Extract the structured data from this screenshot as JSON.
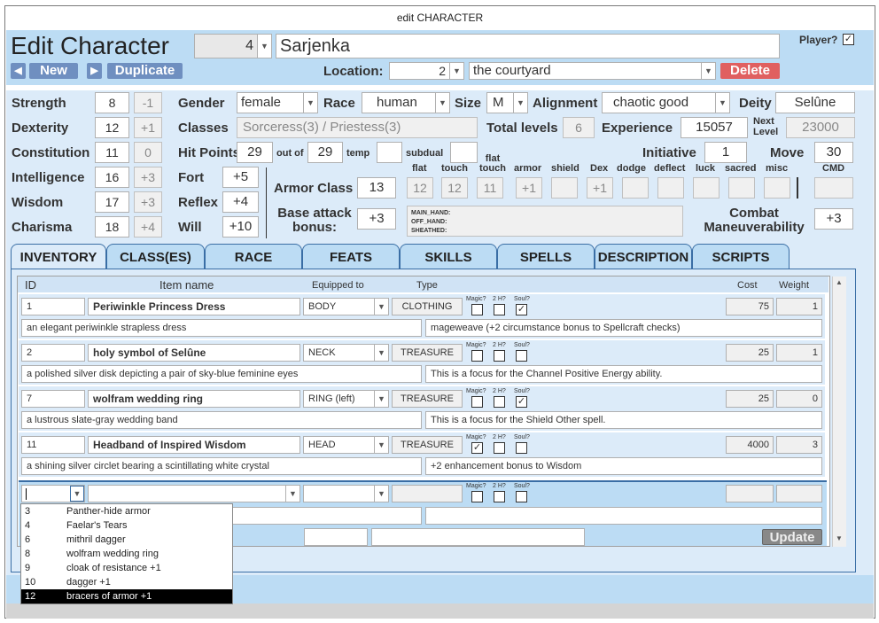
{
  "window_title": "edit CHARACTER",
  "header": {
    "title": "Edit Character",
    "id_value": "4",
    "name_value": "Sarjenka",
    "player_label": "Player?",
    "player_checked": "☑",
    "new_label": "New",
    "duplicate_label": "Duplicate",
    "location_label": "Location:",
    "location_id": "2",
    "location_name": "the courtyard",
    "delete_label": "Delete"
  },
  "abilities": [
    {
      "label": "Strength",
      "value": "8",
      "mod": "-1"
    },
    {
      "label": "Dexterity",
      "value": "12",
      "mod": "+1"
    },
    {
      "label": "Constitution",
      "value": "11",
      "mod": "0"
    },
    {
      "label": "Intelligence",
      "value": "16",
      "mod": "+3"
    },
    {
      "label": "Wisdom",
      "value": "17",
      "mod": "+3"
    },
    {
      "label": "Charisma",
      "value": "18",
      "mod": "+4"
    }
  ],
  "info": {
    "gender_label": "Gender",
    "gender": "female",
    "race_label": "Race",
    "race": "human",
    "size_label": "Size",
    "size": "M",
    "alignment_label": "Alignment",
    "alignment": "chaotic good",
    "deity_label": "Deity",
    "deity": "Selûne",
    "classes_label": "Classes",
    "classes": "Sorceress(3) / Priestess(3)",
    "total_levels_label": "Total levels",
    "total_levels": "6",
    "experience_label": "Experience",
    "experience": "15057",
    "next_level_label": "Next Level",
    "next_level": "23000",
    "hp_label": "Hit Points",
    "hp": "29",
    "outof_label": "out of",
    "hp_max": "29",
    "temp_label": "temp",
    "subdual_label": "subdual",
    "initiative_label": "Initiative",
    "initiative": "1",
    "move_label": "Move",
    "move": "30"
  },
  "saves": [
    {
      "label": "Fort",
      "value": "+5"
    },
    {
      "label": "Reflex",
      "value": "+4"
    },
    {
      "label": "Will",
      "value": "+10"
    }
  ],
  "armor": {
    "label": "Armor Class",
    "value": "13",
    "flat": "12",
    "touch": "12",
    "flat_touch": "11",
    "armor": "+1",
    "shield": "",
    "dex": "+1",
    "col_flat": "flat",
    "col_touch": "touch",
    "col_flat_touch": "flat touch",
    "col_armor": "armor",
    "col_shield": "shield",
    "col_dex": "Dex",
    "col_dodge": "dodge",
    "col_deflect": "deflect",
    "col_luck": "luck",
    "col_sacred": "sacred",
    "col_misc": "misc",
    "col_cmd": "CMD"
  },
  "bab": {
    "label": "Base attack bonus:",
    "value": "+3",
    "main_hand": "MAIN_HAND:",
    "off_hand": "OFF_HAND:",
    "sheathed": "SHEATHED:"
  },
  "cmb": {
    "label": "Combat Maneuverability",
    "value": "+3"
  },
  "tabs": [
    "INVENTORY",
    "CLASS(ES)",
    "RACE",
    "FEATS",
    "SKILLS",
    "SPELLS",
    "DESCRIPTION",
    "SCRIPTS"
  ],
  "inventory": {
    "headers": {
      "id": "ID",
      "name": "Item name",
      "equipped": "Equipped to",
      "type": "Type",
      "cost": "Cost",
      "weight": "Weight"
    },
    "check_labels": {
      "magic": "Magic?",
      "two_h": "2 H?",
      "soul": "Soul?"
    },
    "items": [
      {
        "id": "1",
        "name": "Periwinkle Princess Dress",
        "slot": "BODY",
        "type": "CLOTHING",
        "magic": "",
        "two_h": "",
        "soul": "✓",
        "cost": "75",
        "weight": "1",
        "desc": "an elegant periwinkle strapless dress",
        "note": "mageweave (+2 circumstance bonus to Spellcraft checks)"
      },
      {
        "id": "2",
        "name": "holy symbol of Selûne",
        "slot": "NECK",
        "type": "TREASURE",
        "magic": "",
        "two_h": "",
        "soul": "",
        "cost": "25",
        "weight": "1",
        "desc": "a polished silver disk depicting a pair of sky-blue feminine eyes",
        "note": "This is a focus for the Channel Positive Energy ability."
      },
      {
        "id": "7",
        "name": "wolfram wedding ring",
        "slot": "RING (left)",
        "type": "TREASURE",
        "magic": "",
        "two_h": "",
        "soul": "✓",
        "cost": "25",
        "weight": "0",
        "desc": "a lustrous slate-gray wedding band",
        "note": "This is a focus for the Shield Other spell."
      },
      {
        "id": "11",
        "name": "Headband of Inspired Wisdom",
        "slot": "HEAD",
        "type": "TREASURE",
        "magic": "✓",
        "two_h": "",
        "soul": "",
        "cost": "4000",
        "weight": "3",
        "desc": "a shining silver circlet bearing a scintillating white crystal",
        "note": "+2 enhancement bonus to Wisdom"
      }
    ],
    "update_label": "Update",
    "dropdown": [
      {
        "id": "3",
        "name": "Panther-hide armor"
      },
      {
        "id": "4",
        "name": "Faelar's Tears"
      },
      {
        "id": "6",
        "name": "mithril dagger"
      },
      {
        "id": "8",
        "name": "wolfram wedding ring"
      },
      {
        "id": "9",
        "name": "cloak of resistance +1"
      },
      {
        "id": "10",
        "name": "dagger +1"
      },
      {
        "id": "12",
        "name": "bracers of armor +1"
      }
    ]
  },
  "colors": {
    "header_bg": "#bcdcf4",
    "body_bg": "#dcebf9",
    "button_blue": "#6f8fc0",
    "delete_red": "#e06060",
    "tab_border": "#3a6ea5"
  }
}
